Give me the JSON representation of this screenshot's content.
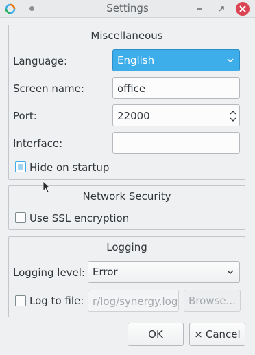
{
  "window": {
    "title": "Settings"
  },
  "misc": {
    "title": "Miscellaneous",
    "language_label": "Language:",
    "language_value": "English",
    "screen_name_label": "Screen name:",
    "screen_name_value": "office",
    "port_label": "Port:",
    "port_value": "22000",
    "interface_label": "Interface:",
    "interface_value": "",
    "hide_label": "Hide on startup",
    "hide_checked": true
  },
  "security": {
    "title": "Network Security",
    "ssl_label": "Use SSL encryption",
    "ssl_checked": false
  },
  "logging": {
    "title": "Logging",
    "level_label": "Logging level:",
    "level_value": "Error",
    "log_file_label": "Log to file:",
    "log_file_value": "r/log/synergy.log",
    "log_file_checked": false,
    "browse_label": "Browse..."
  },
  "buttons": {
    "ok_label": "OK",
    "cancel_label": "Cancel",
    "cancel_icon": "×"
  },
  "colors": {
    "accent": "#3daee9",
    "close": "#da4453"
  }
}
